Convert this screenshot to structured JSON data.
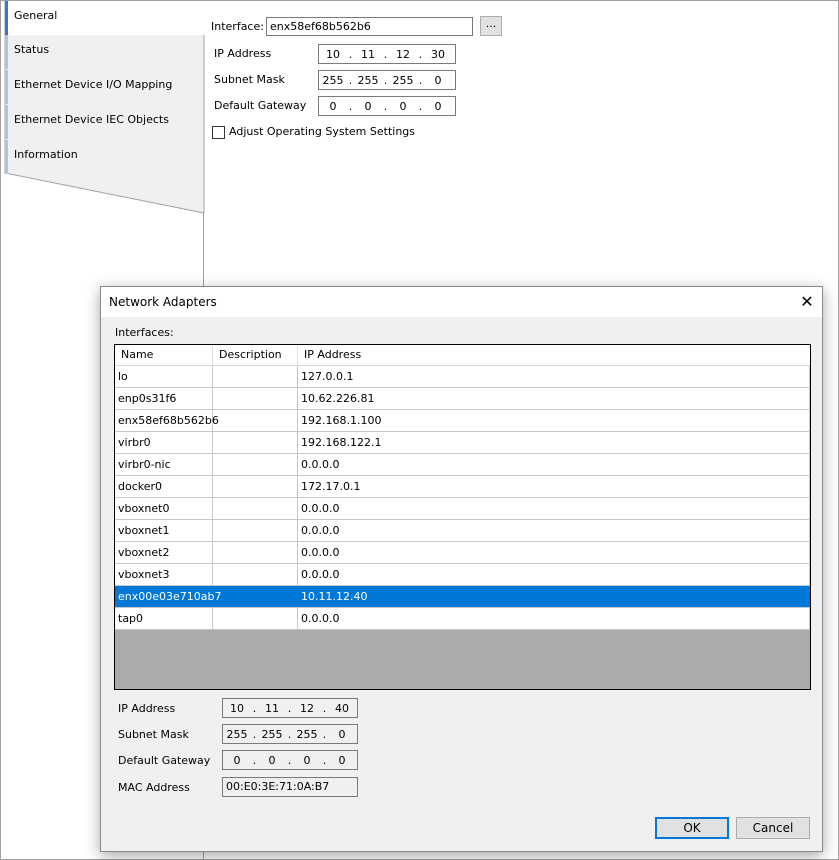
{
  "tabs": [
    {
      "label": "General",
      "active": true
    },
    {
      "label": "Status",
      "active": false
    },
    {
      "label": "Ethernet Device I/O Mapping",
      "active": false
    },
    {
      "label": "Ethernet Device IEC Objects",
      "active": false
    },
    {
      "label": "Information",
      "active": false
    }
  ],
  "general": {
    "interface_label": "Interface:",
    "interface_value": "enx58ef68b562b6",
    "browse_label": "...",
    "ip_label": "IP Address",
    "ip": [
      "10",
      "11",
      "12",
      "30"
    ],
    "subnet_label": "Subnet Mask",
    "subnet": [
      "255",
      "255",
      "255",
      "0"
    ],
    "gateway_label": "Default Gateway",
    "gateway": [
      "0",
      "0",
      "0",
      "0"
    ],
    "adjust_label": "Adjust Operating System Settings",
    "adjust_checked": false
  },
  "dialog": {
    "title": "Network Adapters",
    "close": "✕",
    "interfaces_label": "Interfaces:",
    "columns": [
      "Name",
      "Description",
      "IP Address"
    ],
    "rows": [
      {
        "name": "lo",
        "description": "",
        "ip": "127.0.0.1"
      },
      {
        "name": "enp0s31f6",
        "description": "",
        "ip": "10.62.226.81"
      },
      {
        "name": "enx58ef68b562b6",
        "description": "",
        "ip": "192.168.1.100"
      },
      {
        "name": "virbr0",
        "description": "",
        "ip": "192.168.122.1"
      },
      {
        "name": "virbr0-nic",
        "description": "",
        "ip": "0.0.0.0"
      },
      {
        "name": "docker0",
        "description": "",
        "ip": "172.17.0.1"
      },
      {
        "name": "vboxnet0",
        "description": "",
        "ip": "0.0.0.0"
      },
      {
        "name": "vboxnet1",
        "description": "",
        "ip": "0.0.0.0"
      },
      {
        "name": "vboxnet2",
        "description": "",
        "ip": "0.0.0.0"
      },
      {
        "name": "vboxnet3",
        "description": "",
        "ip": "0.0.0.0"
      },
      {
        "name": "enx00e03e710ab7",
        "description": "",
        "ip": "10.11.12.40",
        "selected": true
      },
      {
        "name": "tap0",
        "description": "",
        "ip": "0.0.0.0"
      }
    ],
    "ip_label": "IP Address",
    "ip": [
      "10",
      "11",
      "12",
      "40"
    ],
    "subnet_label": "Subnet Mask",
    "subnet": [
      "255",
      "255",
      "255",
      "0"
    ],
    "gateway_label": "Default Gateway",
    "gateway": [
      "0",
      "0",
      "0",
      "0"
    ],
    "mac_label": "MAC Address",
    "mac": "00:E0:3E:71:0A:B7",
    "ok_label": "OK",
    "cancel_label": "Cancel"
  },
  "colors": {
    "selection": "#0078d7",
    "tab_active_bar": "#3a78c4",
    "tab_bar": "#a9c5e6"
  }
}
